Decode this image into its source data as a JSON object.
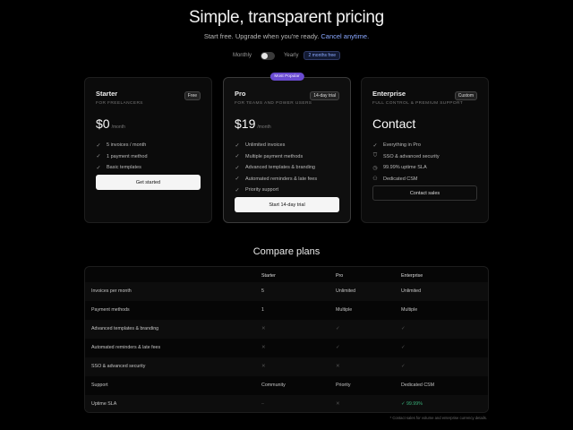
{
  "hero": {
    "title": "Simple, transparent pricing",
    "subtitle": "Start free. Upgrade when you're ready.",
    "subtitle_accent": "Cancel anytime."
  },
  "billing": {
    "monthly": "Monthly",
    "yearly": "Yearly",
    "save": "2 months free"
  },
  "plans": [
    {
      "name": "Starter",
      "tagline": "For freelancers",
      "pill": "Free",
      "price": "$0",
      "per": "/month",
      "features": [
        {
          "icon": "check",
          "text": "5 invoices / month"
        },
        {
          "icon": "check",
          "text": "1 payment method"
        },
        {
          "icon": "check",
          "text": "Basic templates"
        }
      ],
      "cta": "Get started"
    },
    {
      "name": "Pro",
      "tagline": "For teams and power users",
      "pill": "14-day trial",
      "badge": "Most Popular",
      "price": "$19",
      "per": "/month",
      "features": [
        {
          "icon": "check",
          "text": "Unlimited invoices"
        },
        {
          "icon": "check",
          "text": "Multiple payment methods"
        },
        {
          "icon": "check",
          "text": "Advanced templates & branding"
        },
        {
          "icon": "check",
          "text": "Automated reminders & late fees"
        },
        {
          "icon": "check",
          "text": "Priority support"
        }
      ],
      "cta": "Start 14-day trial"
    },
    {
      "name": "Enterprise",
      "tagline": "Full control & premium support",
      "pill": "Custom",
      "price": "Contact",
      "per": "",
      "features": [
        {
          "icon": "check",
          "text": "Everything in Pro"
        },
        {
          "icon": "shield",
          "text": "SSO & advanced security"
        },
        {
          "icon": "clock",
          "text": "99.99% uptime SLA"
        },
        {
          "icon": "person",
          "text": "Dedicated CSM"
        }
      ],
      "cta": "Contact sales"
    }
  ],
  "compare": {
    "title": "Compare plans",
    "columns": [
      "",
      "Starter",
      "Pro",
      "Enterprise"
    ],
    "rows": [
      {
        "label": "Invoices per month",
        "starter": "5",
        "pro": "Unlimited",
        "enterprise": "Unlimited"
      },
      {
        "label": "Payment methods",
        "starter": "1",
        "pro": "Multiple",
        "enterprise": "Multiple"
      },
      {
        "label": "Advanced templates & branding",
        "starter": "✕",
        "pro": "✓",
        "enterprise": "✓"
      },
      {
        "label": "Automated reminders & late fees",
        "starter": "✕",
        "pro": "✓",
        "enterprise": "✓"
      },
      {
        "label": "SSO & advanced security",
        "starter": "✕",
        "pro": "✕",
        "enterprise": "✓"
      },
      {
        "label": "Support",
        "starter": "Community",
        "pro": "Priority",
        "enterprise": "Dedicated CSM"
      },
      {
        "label": "Uptime SLA",
        "starter": "–",
        "pro": "✕",
        "enterprise": "99.99%"
      }
    ]
  },
  "footnote": "* Contact sales for volume and enterprise currency details.",
  "colors": {
    "accent": "#8aa8ff",
    "popular": "#6a4bd1",
    "success": "#3ab07a"
  }
}
